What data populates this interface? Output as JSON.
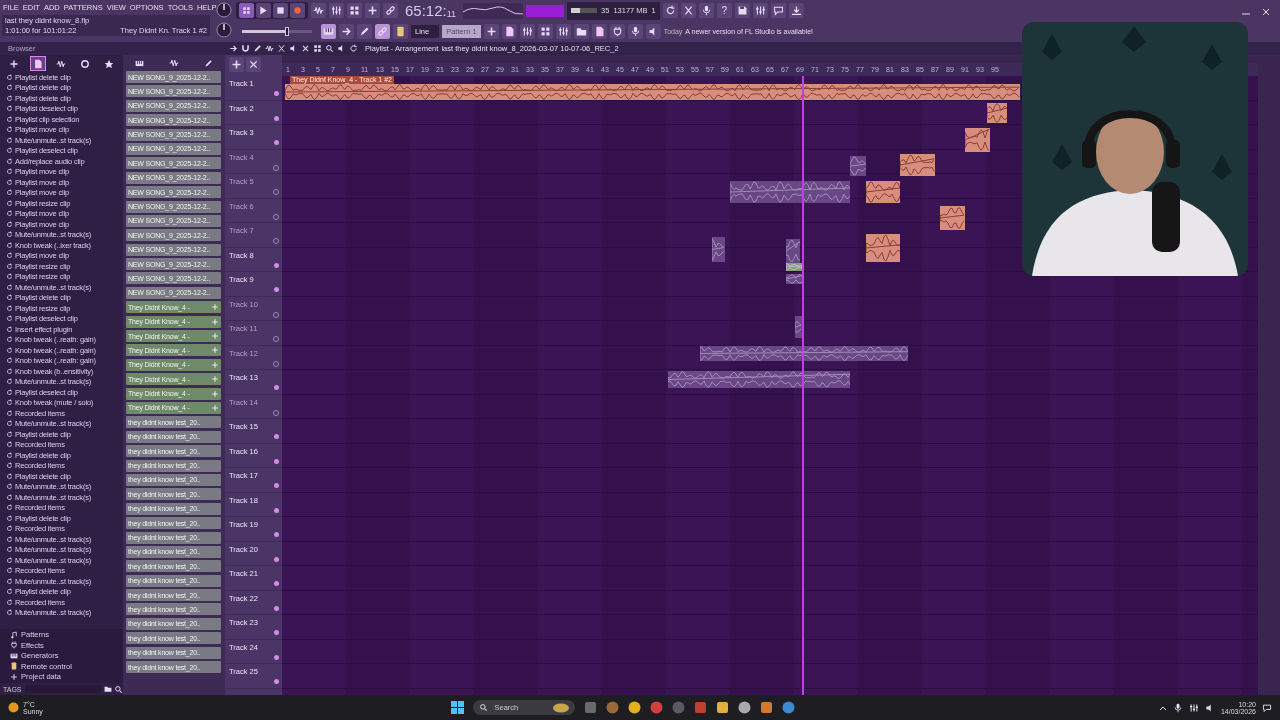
{
  "menu": [
    "FILE",
    "EDIT",
    "ADD",
    "PATTERNS",
    "VIEW",
    "OPTIONS",
    "TOOLS",
    "HELP"
  ],
  "hint": {
    "file": "last they didnt know_8.flp",
    "position": "1:01:00 for 101:01:22",
    "clip": "They Didnt Kn. Track 1 #2"
  },
  "time": {
    "main": "65:12:",
    "small": "11"
  },
  "snap": "Line",
  "slider": {
    "level": 0.64
  },
  "pattern": "Pattern 1",
  "meter": {
    "level": 0.35,
    "cpu": "35",
    "memory": "13177 MB",
    "polyphony": "1"
  },
  "help_button": "?",
  "notice": {
    "when": "Today",
    "text": "A newer version of FL Studio is available!"
  },
  "browser": {
    "title": "Browser",
    "tabs": [
      {
        "kind": "plus",
        "selected": false
      },
      {
        "kind": "doc",
        "selected": true
      },
      {
        "kind": "wave",
        "selected": false
      },
      {
        "kind": "circle",
        "selected": false
      },
      {
        "kind": "star",
        "selected": false
      }
    ],
    "history": [
      "Playlist delete clip",
      "Playlist delete clip",
      "Playlist delete clip",
      "Playlist deselect clip",
      "Playlist clip selection",
      "Playlist move clip",
      "Mute/unmute..st track(s)",
      "Playlist deselect clip",
      "Add/replace audio clip",
      "Playlist move clip",
      "Playlist move clip",
      "Playlist move clip",
      "Playlist resize clip",
      "Playlist move clip",
      "Playlist move clip",
      "Mute/unmute..st track(s)",
      "Knob tweak (..ixer track)",
      "Playlist move clip",
      "Playlist resize clip",
      "Playlist resize clip",
      "Mute/unmute..st track(s)",
      "Playlist delete clip",
      "Playlist resize clip",
      "Playlist deselect clip",
      "Insert effect plugin",
      "Knob tweak (..reath: gain)",
      "Knob tweak (..reath: gain)",
      "Knob tweak (..reath: gain)",
      "Knob tweak (b..ensitivity)",
      "Mute/unmute..st track(s)",
      "Playlist deselect clip",
      "Knob tweak (mute / solo)",
      "Recorded items",
      "Mute/unmute..st track(s)",
      "Playlist delete clip",
      "Recorded items",
      "Playlist delete clip",
      "Recorded items",
      "Playlist delete clip",
      "Mute/unmute..st track(s)",
      "Mute/unmute..st track(s)",
      "Recorded items",
      "Playlist delete clip",
      "Recorded items",
      "Mute/unmute..st track(s)",
      "Mute/unmute..st track(s)",
      "Mute/unmute..st track(s)",
      "Recorded items",
      "Mute/unmute..st track(s)",
      "Playlist delete clip",
      "Recorded items",
      "Mute/unmute..st track(s)"
    ],
    "tree": [
      {
        "kind": "note",
        "label": "Patterns"
      },
      {
        "kind": "plug",
        "label": "Effects"
      },
      {
        "kind": "keys",
        "label": "Generators"
      },
      {
        "kind": "remote",
        "label": "Remote control"
      },
      {
        "kind": "data",
        "label": "Project data"
      }
    ],
    "tags": "TAGS"
  },
  "clip_list": [
    {
      "name": "NEW SONG_9_2025-12-2..",
      "kind": "audio"
    },
    {
      "name": "NEW SONG_9_2025-12-2..",
      "kind": "audio"
    },
    {
      "name": "NEW SONG_9_2025-12-2..",
      "kind": "audio"
    },
    {
      "name": "NEW SONG_9_2025-12-2..",
      "kind": "audio"
    },
    {
      "name": "NEW SONG_9_2025-12-2..",
      "kind": "audio"
    },
    {
      "name": "NEW SONG_9_2025-12-2..",
      "kind": "audio"
    },
    {
      "name": "NEW SONG_9_2025-12-2..",
      "kind": "audio"
    },
    {
      "name": "NEW SONG_9_2025-12-2..",
      "kind": "audio"
    },
    {
      "name": "NEW SONG_9_2025-12-2..",
      "kind": "audio"
    },
    {
      "name": "NEW SONG_9_2025-12-2..",
      "kind": "audio"
    },
    {
      "name": "NEW SONG_9_2025-12-2..",
      "kind": "audio"
    },
    {
      "name": "NEW SONG_9_2025-12-2..",
      "kind": "audio"
    },
    {
      "name": "NEW SONG_9_2025-12-2..",
      "kind": "audio"
    },
    {
      "name": "NEW SONG_9_2025-12-2..",
      "kind": "audio"
    },
    {
      "name": "NEW SONG_9_2025-12-2..",
      "kind": "audio"
    },
    {
      "name": "NEW SONG_9_2025-12-2..",
      "kind": "audio"
    },
    {
      "name": "They Didnt Know_4 -",
      "kind": "pattern"
    },
    {
      "name": "They Didnt Know_4 -",
      "kind": "pattern"
    },
    {
      "name": "They Didnt Know_4 -",
      "kind": "pattern"
    },
    {
      "name": "They Didnt Know_4 -",
      "kind": "pattern"
    },
    {
      "name": "They Didnt Know_4 -",
      "kind": "pattern"
    },
    {
      "name": "They Didnt Know_4 -",
      "kind": "pattern"
    },
    {
      "name": "They Didnt Know_4 -",
      "kind": "pattern"
    },
    {
      "name": "They Didnt Know_4 -",
      "kind": "pattern"
    },
    {
      "name": "they didnt know test_20..",
      "kind": "audio"
    },
    {
      "name": "they didnt know test_20..",
      "kind": "audio"
    },
    {
      "name": "they didnt know test_20..",
      "kind": "audio"
    },
    {
      "name": "they didnt know test_20..",
      "kind": "audio"
    },
    {
      "name": "they didnt know test_20..",
      "kind": "audio"
    },
    {
      "name": "they didnt know test_20..",
      "kind": "audio"
    },
    {
      "name": "they didnt know test_20..",
      "kind": "audio"
    },
    {
      "name": "they didnt know test_20..",
      "kind": "audio"
    },
    {
      "name": "they didnt know test_20..",
      "kind": "audio"
    },
    {
      "name": "they didnt know test_20..",
      "kind": "audio"
    },
    {
      "name": "they didnt know test_20..",
      "kind": "audio"
    },
    {
      "name": "they didnt know test_20..",
      "kind": "audio"
    },
    {
      "name": "they didnt know test_20..",
      "kind": "audio"
    },
    {
      "name": "they didnt know test_20..",
      "kind": "audio"
    },
    {
      "name": "they didnt know test_20..",
      "kind": "audio"
    },
    {
      "name": "they didnt know test_20..",
      "kind": "audio"
    },
    {
      "name": "they didnt know test_20..",
      "kind": "audio"
    },
    {
      "name": "they didnt know test_20..",
      "kind": "audio"
    }
  ],
  "playlist": {
    "title": "Playlist - Arrangement",
    "path": "last they didnt know_8_2026-03-07 10-07-06_REC_2",
    "first_clip": "They Didnt Know_4 - Track 1 #2",
    "ruler": [
      "1",
      "3",
      "5",
      "7",
      "9",
      "11",
      "13",
      "15",
      "17",
      "19",
      "21",
      "23",
      "25",
      "27",
      "29",
      "31",
      "33",
      "35",
      "37",
      "39",
      "41",
      "43",
      "45",
      "47",
      "49",
      "51",
      "53",
      "55",
      "57",
      "59",
      "61",
      "63",
      "65",
      "67",
      "69",
      "71",
      "73",
      "75",
      "77",
      "79",
      "81",
      "83",
      "85",
      "87",
      "89",
      "91",
      "93",
      "95"
    ],
    "tracks": [
      {
        "name": "Track 1",
        "muted": false
      },
      {
        "name": "Track 2",
        "muted": false
      },
      {
        "name": "Track 3",
        "muted": false
      },
      {
        "name": "Track 4",
        "muted": true
      },
      {
        "name": "Track 5",
        "muted": true
      },
      {
        "name": "Track 6",
        "muted": true
      },
      {
        "name": "Track 7",
        "muted": true
      },
      {
        "name": "Track 8",
        "muted": false
      },
      {
        "name": "Track 9",
        "muted": false
      },
      {
        "name": "Track 10",
        "muted": true
      },
      {
        "name": "Track 11",
        "muted": true
      },
      {
        "name": "Track 12",
        "muted": true
      },
      {
        "name": "Track 13",
        "muted": false
      },
      {
        "name": "Track 14",
        "muted": true
      },
      {
        "name": "Track 15",
        "muted": false
      },
      {
        "name": "Track 16",
        "muted": false
      },
      {
        "name": "Track 17",
        "muted": false
      },
      {
        "name": "Track 18",
        "muted": false
      },
      {
        "name": "Track 19",
        "muted": false
      },
      {
        "name": "Track 20",
        "muted": false
      },
      {
        "name": "Track 21",
        "muted": false
      },
      {
        "name": "Track 22",
        "muted": false
      },
      {
        "name": "Track 23",
        "muted": false
      },
      {
        "name": "Track 24",
        "muted": false
      },
      {
        "name": "Track 25",
        "muted": false
      }
    ]
  },
  "taskbar": {
    "temperature": "7°C",
    "weather": "Sunny",
    "search": "Search",
    "time": "10:20",
    "date": "14/03/2026"
  }
}
